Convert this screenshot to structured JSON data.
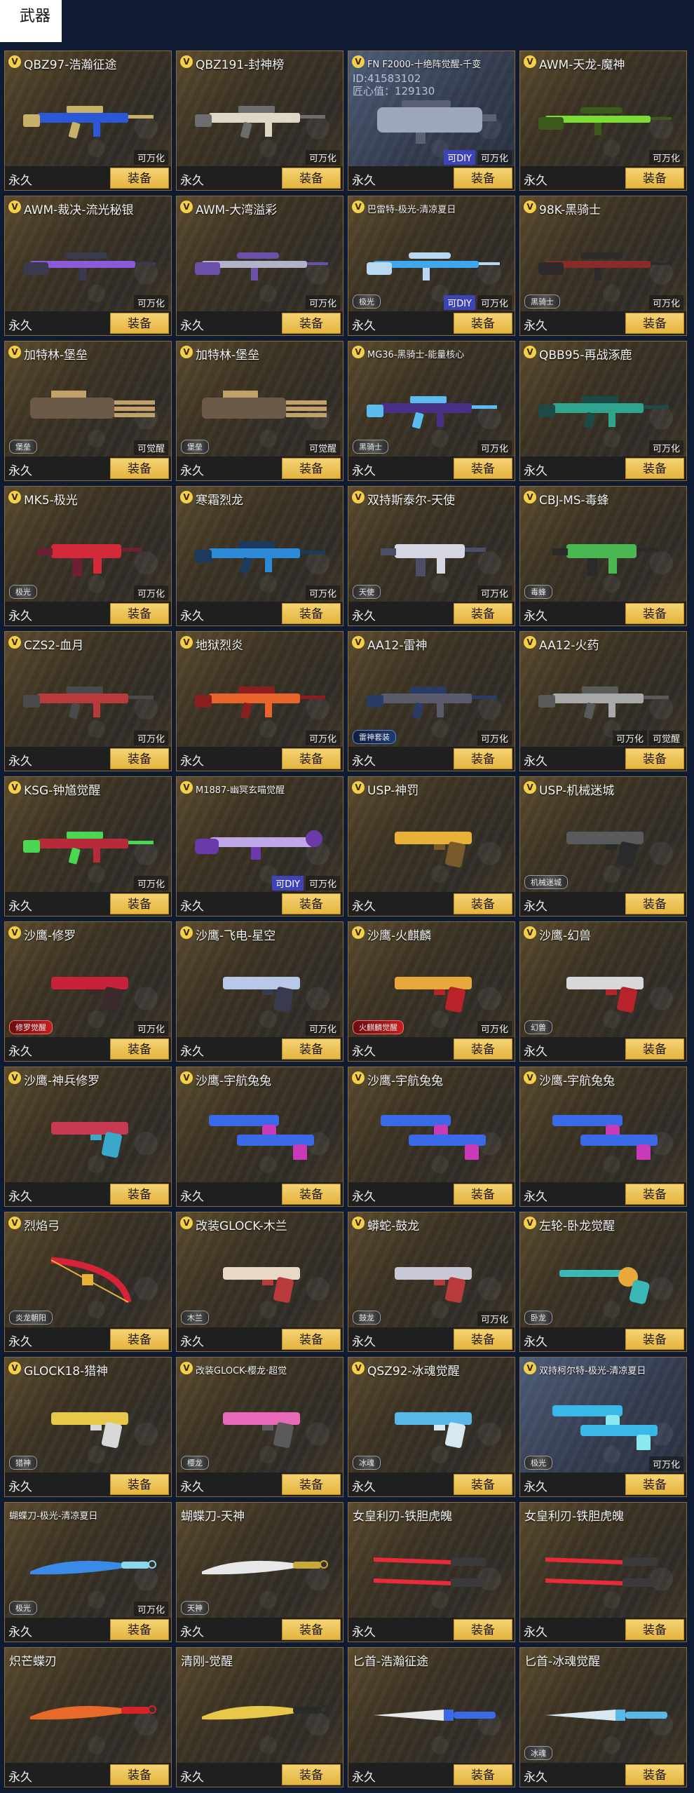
{
  "page": {
    "tab_label": "武器"
  },
  "ui": {
    "duration": "永久",
    "equip_label": "装备",
    "v_badge": "V"
  },
  "colors": {
    "accent": "#f0c24a",
    "background": "#0f1a33",
    "card": "#3b3222"
  },
  "icons": {
    "weapon": "weapon-icon",
    "badge": "vip-badge-icon"
  },
  "weapons": [
    {
      "name": "QBZ97-浩瀚征途",
      "flags": [
        "可万化"
      ],
      "tag": "",
      "colors": [
        "#2b58d6",
        "#c9b06a"
      ],
      "type": "rifle",
      "vb": true
    },
    {
      "name": "QBZ191-封神榜",
      "flags": [
        "可万化"
      ],
      "tag": "",
      "colors": [
        "#ded7c5",
        "#6d6d6d"
      ],
      "type": "rifle",
      "vb": true
    },
    {
      "name": "FN F2000-十绝阵觉醒-千变",
      "extra": [
        "ID:41583102",
        "匠心值：129130"
      ],
      "flags": [
        "可DIY",
        "可万化"
      ],
      "tag": "",
      "colors": [
        "#9ea8bd",
        "#5a6173"
      ],
      "type": "bulky",
      "vb": true,
      "small": true,
      "blue": true
    },
    {
      "name": "AWM-天龙-魔神",
      "flags": [
        "可万化"
      ],
      "tag": "",
      "colors": [
        "#7bdc33",
        "#3b5a1c"
      ],
      "type": "sniper",
      "vb": true
    },
    {
      "name": "AWM-裁决-流光秘银",
      "flags": [
        "可万化"
      ],
      "tag": "",
      "colors": [
        "#8a5ad8",
        "#3a3a4e"
      ],
      "type": "sniper",
      "vb": true
    },
    {
      "name": "AWM-大湾溢彩",
      "flags": [
        "可万化"
      ],
      "tag": "",
      "colors": [
        "#b1b1c8",
        "#6b4fa8"
      ],
      "type": "sniper",
      "vb": true
    },
    {
      "name": "巴雷特-极光-清凉夏日",
      "flags": [
        "可DIY",
        "可万化"
      ],
      "tag": "极光",
      "colors": [
        "#3ea7f0",
        "#b9d9f2"
      ],
      "type": "sniper",
      "vb": true,
      "small": true
    },
    {
      "name": "98K-黑骑士",
      "flags": [
        "可万化"
      ],
      "tag": "黑骑士",
      "colors": [
        "#8a2a2a",
        "#2e2a2a"
      ],
      "type": "sniper",
      "vb": true
    },
    {
      "name": "加特林-堡垒",
      "flags": [
        "可觉醒"
      ],
      "tag": "堡垒",
      "colors": [
        "#6b5a47",
        "#c2a06a"
      ],
      "type": "gatling",
      "vb": true
    },
    {
      "name": "加特林-堡垒",
      "flags": [
        "可觉醒"
      ],
      "tag": "堡垒",
      "colors": [
        "#6b5a47",
        "#c2a06a"
      ],
      "type": "gatling",
      "vb": true
    },
    {
      "name": "MG36-黑骑士-能量核心",
      "flags": [
        "可万化"
      ],
      "tag": "黑骑士",
      "colors": [
        "#4a2f86",
        "#5bbcf0"
      ],
      "type": "rifle",
      "vb": true,
      "small": true
    },
    {
      "name": "QBB95-再战涿鹿",
      "flags": [
        "可万化"
      ],
      "tag": "",
      "colors": [
        "#2fa58f",
        "#1d4a45"
      ],
      "type": "rifle",
      "vb": true
    },
    {
      "name": "MK5-极光",
      "flags": [
        "可万化"
      ],
      "tag": "极光",
      "colors": [
        "#d32a3a",
        "#6b2034"
      ],
      "type": "smg",
      "vb": true
    },
    {
      "name": "寒霜烈龙",
      "flags": [
        "可万化"
      ],
      "tag": "",
      "colors": [
        "#2c8ad8",
        "#1b3a5e"
      ],
      "type": "rifle",
      "vb": true
    },
    {
      "name": "双持斯泰尔-天使",
      "flags": [
        "可万化"
      ],
      "tag": "天使",
      "colors": [
        "#d6d6e3",
        "#4a4e66"
      ],
      "type": "smg",
      "vb": true
    },
    {
      "name": "CBJ-MS-毒蜂",
      "flags": [],
      "tag": "毒蜂",
      "colors": [
        "#4ab852",
        "#2a2a2a"
      ],
      "type": "smg",
      "vb": true
    },
    {
      "name": "CZS2-血月",
      "flags": [
        "可万化"
      ],
      "tag": "",
      "colors": [
        "#b83a3a",
        "#4a4a4a"
      ],
      "type": "rifle",
      "vb": true
    },
    {
      "name": "地狱烈炎",
      "flags": [
        "可万化"
      ],
      "tag": "",
      "colors": [
        "#e8642a",
        "#8a1f1f"
      ],
      "type": "rifle",
      "vb": true
    },
    {
      "name": "AA12-雷神",
      "flags": [
        "可万化"
      ],
      "tag": "雷神套装",
      "colors": [
        "#5a5a6b",
        "#2a3b66"
      ],
      "type": "rifle",
      "vb": true
    },
    {
      "name": "AA12-火药",
      "flags": [
        "可万化",
        "可觉醒"
      ],
      "tag": "",
      "colors": [
        "#a8a8a8",
        "#5a5a5a"
      ],
      "type": "rifle",
      "vb": true
    },
    {
      "name": "KSG-钟馗觉醒",
      "flags": [
        "可万化"
      ],
      "tag": "",
      "colors": [
        "#b62a3a",
        "#4ad852"
      ],
      "type": "rifle",
      "vb": true
    },
    {
      "name": "M1887-幽冥玄喵觉醒",
      "flags": [
        "可DIY",
        "可万化"
      ],
      "tag": "",
      "colors": [
        "#c0a8e8",
        "#6a3aa8"
      ],
      "type": "shotgun",
      "vb": true,
      "small": true
    },
    {
      "name": "USP-神罚",
      "flags": [],
      "tag": "",
      "colors": [
        "#e8b13a",
        "#7a5a2a"
      ],
      "type": "pistol",
      "vb": true
    },
    {
      "name": "USP-机械迷城",
      "flags": [],
      "tag": "机械迷城",
      "colors": [
        "#5a5a5a",
        "#2a2a2a"
      ],
      "type": "pistol",
      "vb": true
    },
    {
      "name": "沙鹰-修罗",
      "flags": [
        "可万化"
      ],
      "tag": "修罗觉醒",
      "colors": [
        "#c8223a",
        "#3a2a2a"
      ],
      "type": "pistol",
      "vb": true,
      "redtag": true
    },
    {
      "name": "沙鹰-飞电-星空",
      "flags": [
        "可万化"
      ],
      "tag": "",
      "colors": [
        "#b8c8e8",
        "#3a3a4e"
      ],
      "type": "pistol",
      "vb": true
    },
    {
      "name": "沙鹰-火麒麟",
      "flags": [
        "可万化"
      ],
      "tag": "火麒麟觉醒",
      "colors": [
        "#e8a83a",
        "#b8222a"
      ],
      "type": "pistol",
      "vb": true,
      "redtag": true
    },
    {
      "name": "沙鹰-幻兽",
      "flags": [],
      "tag": "幻兽",
      "colors": [
        "#d8d8d8",
        "#b8222a"
      ],
      "type": "pistol",
      "vb": true
    },
    {
      "name": "沙鹰-神兵修罗",
      "flags": [],
      "tag": "",
      "colors": [
        "#c83a52",
        "#3aa8c8"
      ],
      "type": "pistol",
      "vb": true
    },
    {
      "name": "沙鹰-宇航兔兔",
      "flags": [],
      "tag": "",
      "colors": [
        "#3a6ae8",
        "#c83ab8"
      ],
      "type": "dual",
      "vb": true
    },
    {
      "name": "沙鹰-宇航兔兔",
      "flags": [],
      "tag": "",
      "colors": [
        "#3a6ae8",
        "#c83ab8"
      ],
      "type": "dual",
      "vb": true
    },
    {
      "name": "沙鹰-宇航兔兔",
      "flags": [],
      "tag": "",
      "colors": [
        "#3a6ae8",
        "#c83ab8"
      ],
      "type": "dual",
      "vb": true
    },
    {
      "name": "烈焰弓",
      "flags": [],
      "tag": "炎龙朝阳",
      "colors": [
        "#d8223a",
        "#e8b13a"
      ],
      "type": "bow",
      "vb": true
    },
    {
      "name": "改装GLOCK-木兰",
      "flags": [],
      "tag": "木兰",
      "colors": [
        "#e8d8c8",
        "#b83a3a"
      ],
      "type": "pistol",
      "vb": true
    },
    {
      "name": "蟒蛇-鼓龙",
      "flags": [
        "可万化"
      ],
      "tag": "鼓龙",
      "colors": [
        "#c8c8d8",
        "#b83a3a"
      ],
      "type": "pistol",
      "vb": true
    },
    {
      "name": "左轮-卧龙觉醒",
      "flags": [],
      "tag": "卧龙",
      "colors": [
        "#3ab8b8",
        "#e8a83a"
      ],
      "type": "revolver",
      "vb": true
    },
    {
      "name": "GLOCK18-猎神",
      "flags": [],
      "tag": "猎神",
      "colors": [
        "#e8c84a",
        "#d8d8d8"
      ],
      "type": "pistol",
      "vb": true
    },
    {
      "name": "改装GLOCK-樱龙·超觉",
      "flags": [],
      "tag": "樱龙",
      "colors": [
        "#e86ab8",
        "#5a5a5a"
      ],
      "type": "pistol",
      "vb": true,
      "small": true
    },
    {
      "name": "QSZ92-冰魂觉醒",
      "flags": [],
      "tag": "冰魂",
      "colors": [
        "#5ab8e8",
        "#d8e8f0"
      ],
      "type": "pistol",
      "vb": true
    },
    {
      "name": "双持柯尔特-极光-清凉夏日",
      "flags": [
        "可万化"
      ],
      "tag": "极光",
      "colors": [
        "#3ab8e8",
        "#8ae8f0"
      ],
      "type": "dual",
      "vb": true,
      "small": true,
      "blue": true
    },
    {
      "name": "蝴蝶刀-极光-清凉夏日",
      "flags": [
        "可万化"
      ],
      "tag": "极光",
      "colors": [
        "#3a8ae8",
        "#8ad8f0"
      ],
      "type": "knife",
      "vb": false,
      "small": true
    },
    {
      "name": "蝴蝶刀-天神",
      "flags": [],
      "tag": "天神",
      "colors": [
        "#e8e8e8",
        "#c8a83a"
      ],
      "type": "knife",
      "vb": false
    },
    {
      "name": "女皇利刃-铁胆虎魄",
      "flags": [],
      "tag": "",
      "colors": [
        "#e82a3a",
        "#3a3a3a"
      ],
      "type": "blades",
      "vb": false
    },
    {
      "name": "女皇利刃-铁胆虎魄",
      "flags": [],
      "tag": "",
      "colors": [
        "#e82a3a",
        "#3a3a3a"
      ],
      "type": "blades",
      "vb": false
    },
    {
      "name": "炽芒蝶刃",
      "flags": [],
      "tag": "",
      "colors": [
        "#e86a2a",
        "#d8222a"
      ],
      "type": "knife",
      "vb": false
    },
    {
      "name": "清刚-觉醒",
      "flags": [],
      "tag": "",
      "colors": [
        "#e8c84a",
        "#2a2a2a"
      ],
      "type": "knife",
      "vb": false
    },
    {
      "name": "匕首-浩瀚征途",
      "flags": [],
      "tag": "",
      "colors": [
        "#3a6ae8",
        "#e8e8e8"
      ],
      "type": "dagger",
      "vb": false
    },
    {
      "name": "匕首-冰魂觉醒",
      "flags": [],
      "tag": "冰魂",
      "colors": [
        "#5ab8e8",
        "#d8e8f0"
      ],
      "type": "dagger",
      "vb": false
    }
  ]
}
